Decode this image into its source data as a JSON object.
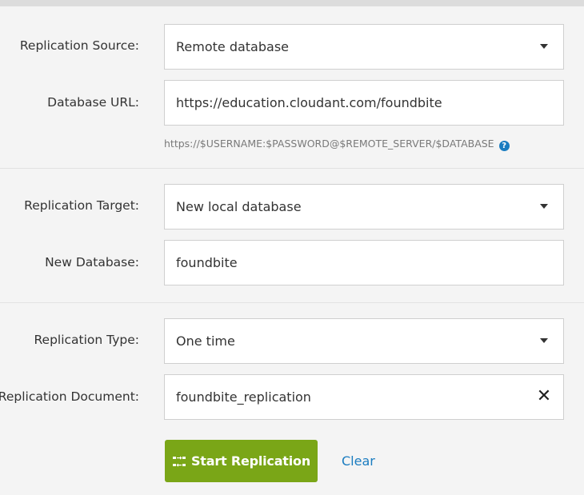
{
  "source": {
    "label": "Replication Source:",
    "value": "Remote database"
  },
  "database_url": {
    "label": "Database URL:",
    "value": "https://education.cloudant.com/foundbite",
    "hint": "https://$USERNAME:$PASSWORD@$REMOTE_SERVER/$DATABASE",
    "help_glyph": "?"
  },
  "target": {
    "label": "Replication Target:",
    "value": "New local database"
  },
  "new_database": {
    "label": "New Database:",
    "value": "foundbite"
  },
  "replication_type": {
    "label": "Replication Type:",
    "value": "One time"
  },
  "replication_document": {
    "label": "Replication Document:",
    "value": "foundbite_replication",
    "clear_glyph": "✕"
  },
  "actions": {
    "start_label": "Start Replication",
    "clear_label": "Clear"
  },
  "colors": {
    "primary_button": "#7aa617",
    "link": "#1a7cc0"
  }
}
